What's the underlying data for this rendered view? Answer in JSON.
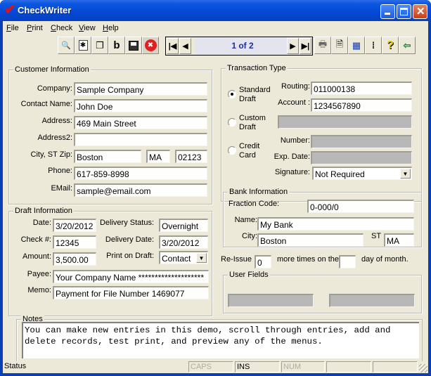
{
  "window": {
    "title": "CheckWriter",
    "accent": "#0548d4"
  },
  "menu": [
    {
      "label": "File",
      "mnemonic": "F",
      "rest": "ile"
    },
    {
      "label": "Print",
      "mnemonic": "P",
      "rest": "rint"
    },
    {
      "label": "Check",
      "mnemonic": "C",
      "rest": "heck"
    },
    {
      "label": "View",
      "mnemonic": "V",
      "rest": "iew"
    },
    {
      "label": "Help",
      "mnemonic": "H",
      "rest": "elp"
    }
  ],
  "toolbar_left": [
    {
      "icon": "binoculars-icon",
      "glyph": "🔍"
    },
    {
      "icon": "new-record-icon",
      "glyph": "✱"
    },
    {
      "icon": "copy-icon",
      "glyph": "❐"
    },
    {
      "icon": "bold-b-icon",
      "glyph": "b"
    },
    {
      "icon": "save-icon",
      "glyph": "💾"
    },
    {
      "icon": "delete-icon",
      "glyph": "✖"
    }
  ],
  "navigation": {
    "first": "⏮",
    "prev": "◀",
    "counter": "1 of 2",
    "next": "▶",
    "last": "⏭"
  },
  "toolbar_right": [
    {
      "icon": "printer-icon",
      "glyph": "🖶"
    },
    {
      "icon": "document-icon",
      "glyph": "🗎"
    },
    {
      "icon": "window-icon",
      "glyph": "▦"
    },
    {
      "icon": "fields-icon",
      "glyph": "⁞"
    },
    {
      "icon": "help-icon",
      "glyph": "?"
    },
    {
      "icon": "exit-icon",
      "glyph": "⇦"
    }
  ],
  "customer": {
    "title": "Customer Information",
    "company_label": "Company:",
    "company": "Sample Company",
    "contact_label": "Contact Name:",
    "contact": "John Doe",
    "address_label": "Address:",
    "address": "469 Main Street",
    "address2_label": "Address2:",
    "address2": "",
    "city_label": "City, ST  Zip:",
    "city": "Boston",
    "state": "MA",
    "zip": "02123",
    "phone_label": "Phone:",
    "phone": "617-859-8998",
    "email_label": "EMail:",
    "email": "sample@email.com"
  },
  "transaction": {
    "title": "Transaction Type",
    "options": [
      {
        "line1": "Standard",
        "line2": "Draft",
        "selected": true
      },
      {
        "line1": "Custom",
        "line2": "Draft",
        "selected": false
      },
      {
        "line1": "Credit",
        "line2": "Card",
        "selected": false
      }
    ],
    "routing_label": "Routing:",
    "routing": "011000138",
    "account_label": "Account :",
    "account": "1234567890",
    "custom": "",
    "number_label": "Number:",
    "number": "",
    "exp_label": "Exp. Date:",
    "exp": "",
    "signature_label": "Signature:",
    "signature": "Not Required"
  },
  "draft": {
    "title": "Draft Information",
    "date_label": "Date:",
    "date": "3/20/2012",
    "check_label": "Check #:",
    "check": "12345",
    "amount_label": "Amount:",
    "amount": "3,500.00",
    "delivery_status_label": "Delivery Status:",
    "delivery_status": "Overnight",
    "delivery_date_label": "Delivery Date:",
    "delivery_date": "3/20/2012",
    "print_on_label": "Print on Draft:",
    "print_on": "Contact",
    "payee_label": "Payee:",
    "payee": "Your Company Name ********************",
    "memo_label": "Memo:",
    "memo": "Payment for File Number 1469077"
  },
  "bank": {
    "title": "Bank Information",
    "fraction_label": "Fraction Code:",
    "fraction": "0-000/0",
    "name_label": "Name:",
    "name": "My Bank",
    "city_label": "City:",
    "city": "Boston",
    "st_label": "ST",
    "st": "MA"
  },
  "reissue": {
    "prefix": "Re-Issue",
    "count": "0",
    "middle": "more times on the",
    "day": "",
    "suffix": "day of month."
  },
  "user_fields": {
    "title": "User Fields",
    "field1": "",
    "field2": ""
  },
  "notes": {
    "title": "Notes",
    "text": "You can make new entries in this demo, scroll through entries, add and delete records, test print, and preview any of the menus."
  },
  "status": {
    "text": "Status",
    "caps": "CAPS",
    "ins": "INS",
    "num": "NUM",
    "p5": "",
    "p6": ""
  }
}
